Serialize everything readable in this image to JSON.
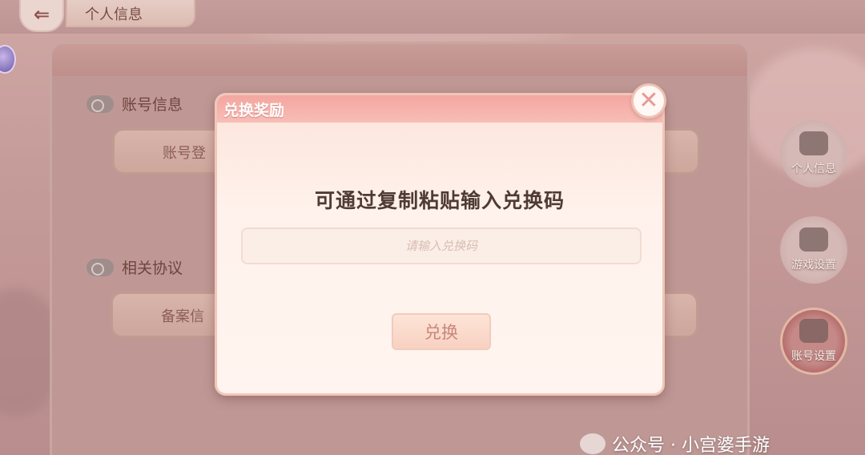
{
  "header": {
    "title": "个人信息",
    "back_icon": "back-arrow-icon"
  },
  "sections": [
    {
      "title": "账号信息",
      "field": "账号登"
    },
    {
      "title": "相关协议",
      "field": "备案信"
    }
  ],
  "side_nav": [
    {
      "label": "个人信息",
      "icon": "person-card-icon",
      "active": false
    },
    {
      "label": "游戏设置",
      "icon": "gamepad-gear-icon",
      "active": false
    },
    {
      "label": "账号设置",
      "icon": "user-gear-icon",
      "active": true
    }
  ],
  "modal": {
    "title": "兑换奖励",
    "prompt": "可通过复制粘贴输入兑换码",
    "input_placeholder": "请输入兑换码",
    "input_value": "",
    "button_label": "兑换",
    "close_icon": "close-icon"
  },
  "watermark": "公众号 · 小宫婆手游",
  "colors": {
    "modal_header": "#f4a6a0",
    "modal_bg": "#fff4ef",
    "button_text": "#c8867a",
    "active_nav": "#9e4745"
  }
}
